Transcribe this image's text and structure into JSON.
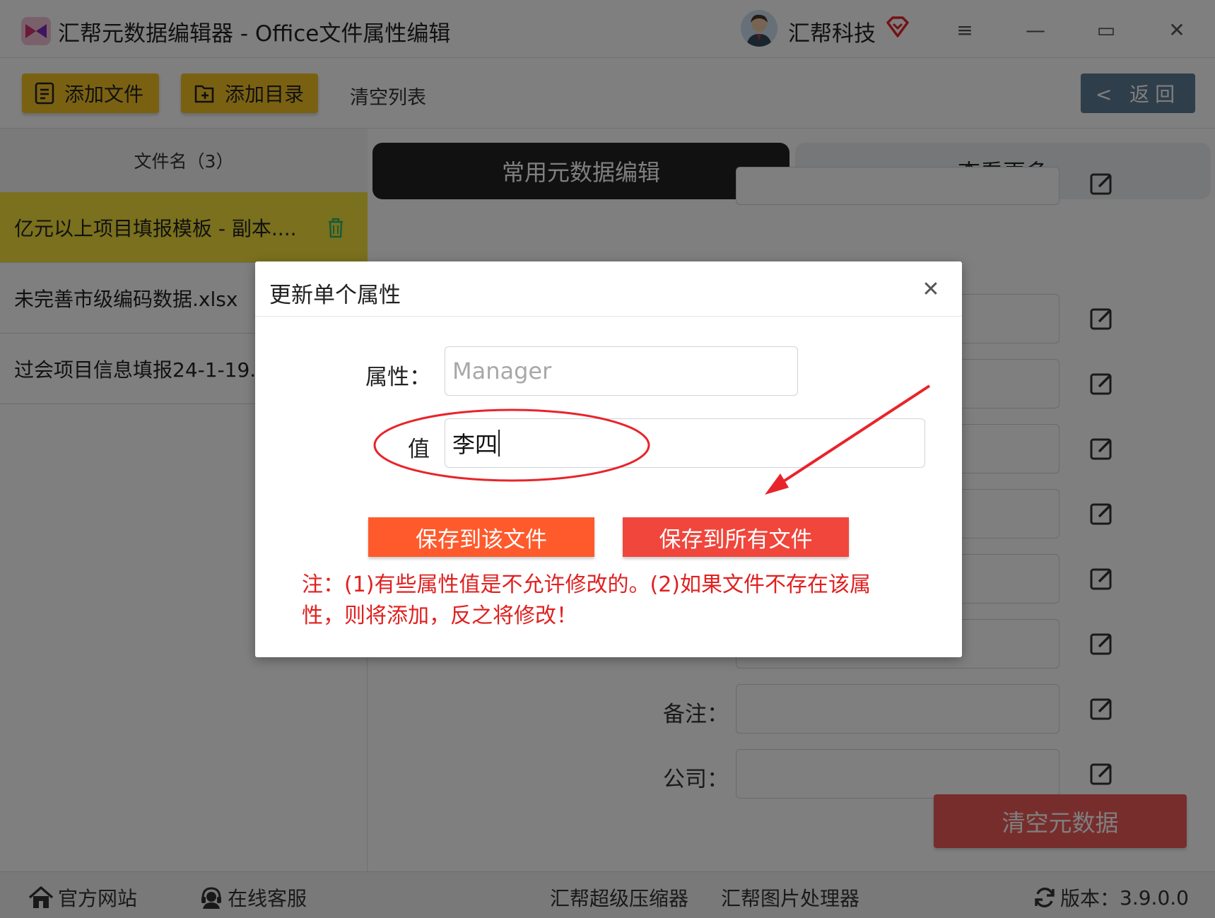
{
  "window": {
    "title": "汇帮元数据编辑器 - Office文件属性编辑",
    "company": "汇帮科技",
    "controls": {
      "menu": "≡",
      "minimize": "—",
      "maximize": "▭",
      "close": "✕"
    }
  },
  "toolbar": {
    "add_file": "添加文件",
    "add_folder": "添加目录",
    "clear_list": "清空列表",
    "back": "< 返回"
  },
  "file_list": {
    "header": "文件名（3）",
    "items": [
      {
        "name": "亿元以上项目填报模板 - 副本...."
      },
      {
        "name": "未完善市级编码数据.xlsx"
      },
      {
        "name": "过会项目信息填报24-1-19.x"
      }
    ]
  },
  "tabs": {
    "common": "常用元数据编辑",
    "more": "查看更多"
  },
  "metadata_fields": {
    "remarks_label": "备注：",
    "company_label": "公司："
  },
  "actions": {
    "clear_metadata": "清空元数据"
  },
  "dialog": {
    "title": "更新单个属性",
    "close": "✕",
    "property_label": "属性：",
    "property_placeholder": "Manager",
    "value_label": "值",
    "value": "李四",
    "save_this": "保存到该文件",
    "save_all": "保存到所有文件",
    "note": "注：(1)有些属性值是不允许修改的。(2)如果文件不存在该属性，则将添加，反之将修改！"
  },
  "statusbar": {
    "website": "官方网站",
    "support": "在线客服",
    "compressor": "汇帮超级压缩器",
    "image_tool": "汇帮图片处理器",
    "version_label": "版本：",
    "version": "3.9.0.0"
  },
  "colors": {
    "accent_yellow": "#f5c325",
    "active_row": "#f4e03a",
    "back_button": "#5f7d96",
    "save_this": "#ff5a2c",
    "save_all": "#f0463c",
    "clear_button": "#f15a5a",
    "note_red": "#e02020",
    "annotation_red": "#e8242a"
  }
}
